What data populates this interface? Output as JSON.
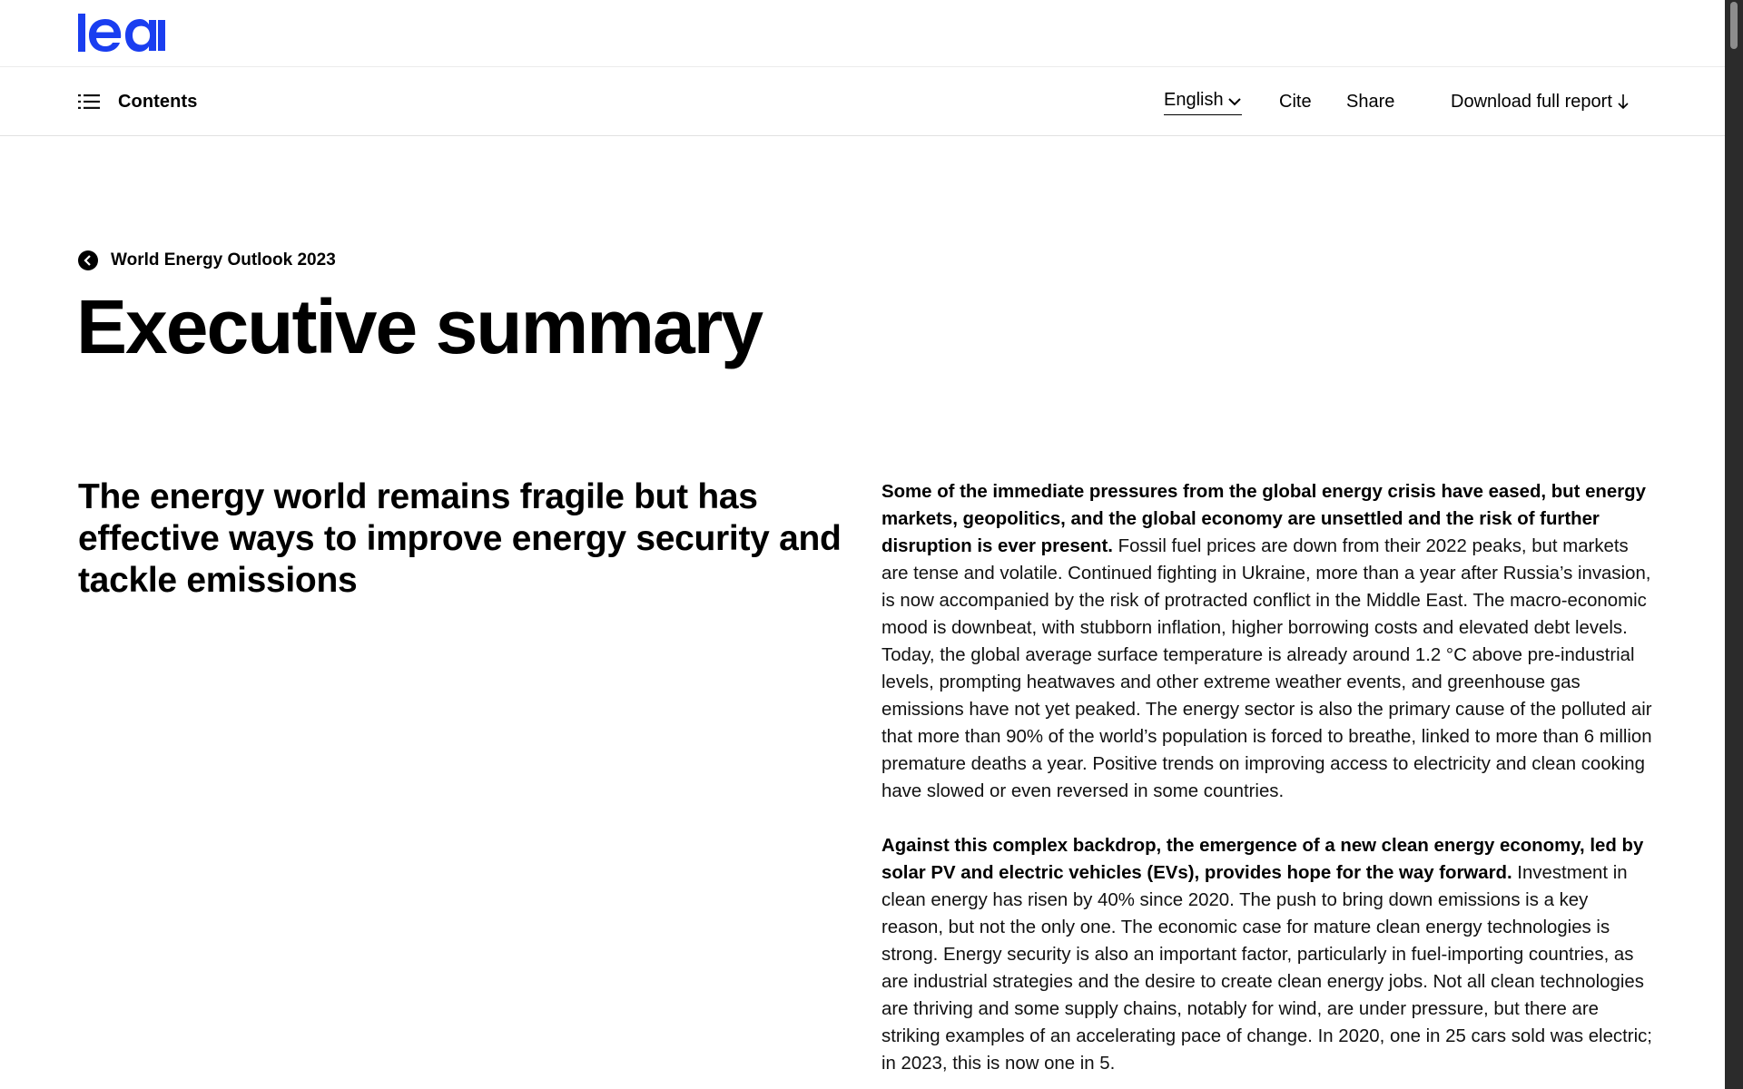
{
  "header": {
    "logo_text": "iea",
    "logo_icon": "iea-logo",
    "brand_color": "#1A3EF0"
  },
  "subnav": {
    "contents_label": "Contents",
    "contents_icon": "list-icon",
    "language_label": "English",
    "language_icon": "chevron-down-icon",
    "cite_label": "Cite",
    "share_label": "Share",
    "download_label": "Download full report",
    "download_icon": "arrow-down-icon"
  },
  "breadcrumb": {
    "back_icon": "chevron-left-circle-icon",
    "label": "World Energy Outlook 2023"
  },
  "page": {
    "title": "Executive summary",
    "section_heading": "The energy world remains fragile but has effective ways to improve energy security and tackle emissions"
  },
  "body": {
    "p1_lead": "Some of the immediate pressures from the global energy crisis have eased, but energy markets, geopolitics, and the global economy are unsettled and the risk of further disruption is ever present.",
    "p1_text": " Fossil fuel prices are down from their 2022 peaks, but markets are tense and volatile. Continued fighting in Ukraine, more than a year after Russia’s invasion, is now accompanied by the risk of protracted conflict in the Middle East. The macro-economic mood is downbeat, with stubborn inflation, higher borrowing costs and elevated debt levels. Today, the global average surface temperature is already around 1.2 °C above pre-industrial levels, prompting heatwaves and other extreme weather events, and greenhouse gas emissions have not yet peaked. The energy sector is also the primary cause of the polluted air that more than 90% of the world’s population is forced to breathe, linked to more than 6 million premature deaths a year. Positive trends on improving access to electricity and clean cooking have slowed or even reversed in some countries.",
    "p2_lead": "Against this complex backdrop, the emergence of a new clean energy economy, led by solar PV and electric vehicles (EVs), provides hope for the way forward.",
    "p2_text": " Investment in clean energy has risen by 40% since 2020. The push to bring down emissions is a key reason, but not the only one. The economic case for mature clean energy technologies is strong. Energy security is also an important factor, particularly in fuel-importing countries, as are industrial strategies and the desire to create clean energy jobs. Not all clean technologies are thriving and some supply chains, notably for wind, are under pressure, but there are striking examples of an accelerating pace of change. In 2020, one in 25 cars sold was electric; in 2023, this is now one in 5."
  }
}
